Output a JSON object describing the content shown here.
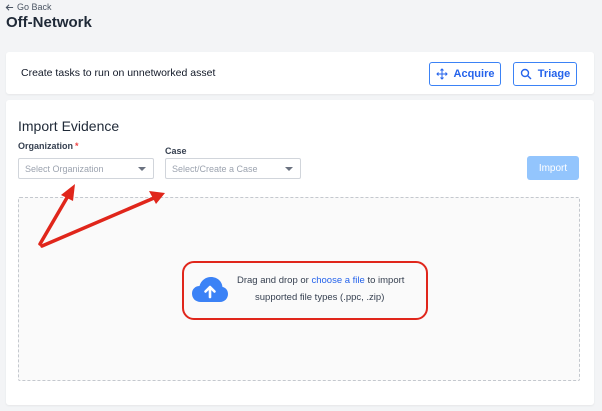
{
  "nav": {
    "back_label": "Go Back"
  },
  "page": {
    "title": "Off-Network"
  },
  "task_card": {
    "text": "Create tasks to run on unnetworked asset",
    "acquire_label": "Acquire",
    "triage_label": "Triage"
  },
  "import": {
    "title": "Import Evidence",
    "org_label": "Organization",
    "org_required": "*",
    "org_placeholder": "Select Organization",
    "case_label": "Case",
    "case_placeholder": "Select/Create a Case",
    "import_label": "Import",
    "drop_prefix": "Drag and drop or ",
    "drop_link": "choose a file",
    "drop_suffix": " to import",
    "drop_types": "supported file types (.ppc, .zip)"
  },
  "colors": {
    "accent": "#3b82f6",
    "annotation_red": "#e0261b",
    "import_disabled": "#93c5fd"
  }
}
